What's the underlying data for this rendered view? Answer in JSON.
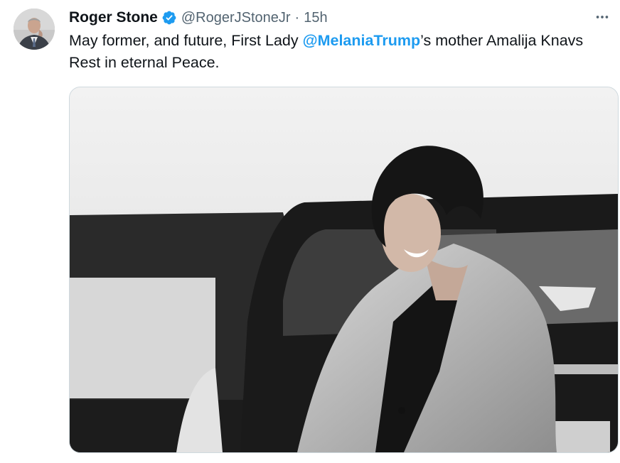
{
  "tweet": {
    "author": {
      "display_name": "Roger Stone",
      "handle": "@RogerJStoneJr",
      "separator": "·",
      "time": "15h",
      "verified": true,
      "verified_icon": "verified-badge-icon",
      "avatar_icon": "avatar"
    },
    "more_icon": "more-options-icon",
    "text": {
      "before": "May former, and future, First Lady ",
      "mention": "@MelaniaTrump",
      "after": "’s mother Amalija Knavs Rest in eternal Peace."
    },
    "media": {
      "type": "photo"
    }
  },
  "colors": {
    "text": "#0f1419",
    "secondary": "#536471",
    "accent": "#1d9bf0"
  }
}
